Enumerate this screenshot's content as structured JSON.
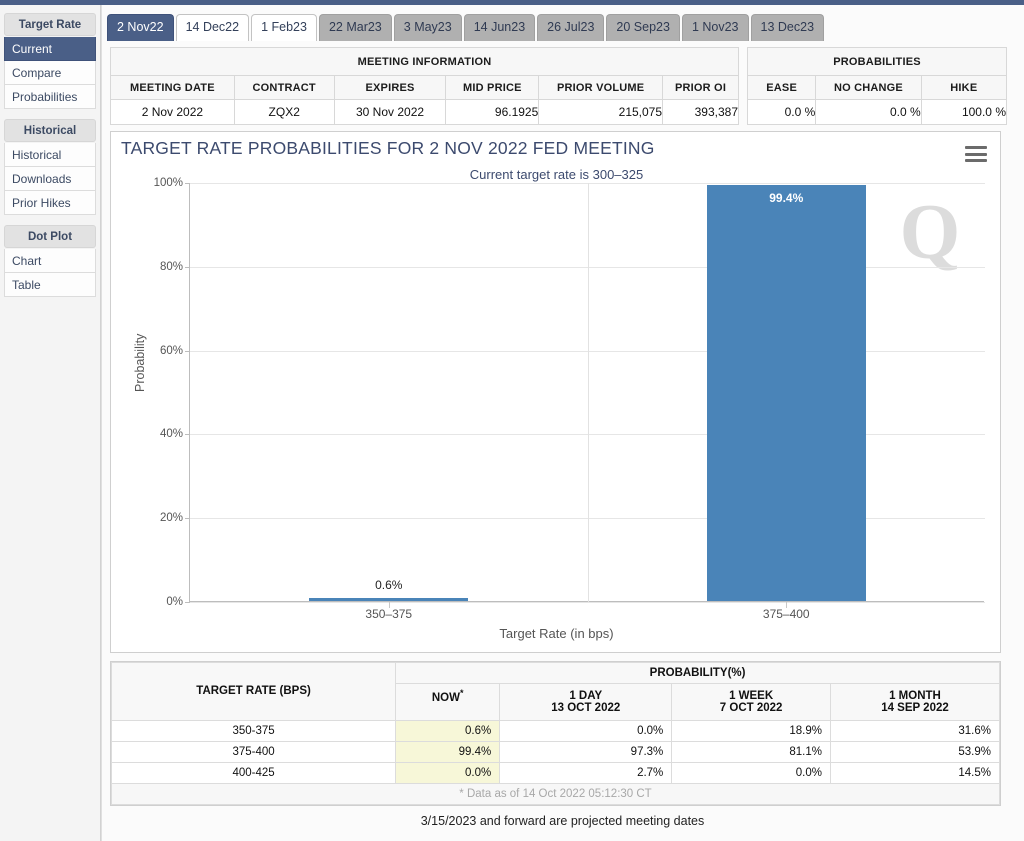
{
  "sidebar": {
    "groups": [
      {
        "title": "Target Rate",
        "items": [
          {
            "label": "Current",
            "active": true
          },
          {
            "label": "Compare",
            "active": false
          },
          {
            "label": "Probabilities",
            "active": false
          }
        ]
      },
      {
        "title": "Historical",
        "items": [
          {
            "label": "Historical",
            "active": false
          },
          {
            "label": "Downloads",
            "active": false
          },
          {
            "label": "Prior Hikes",
            "active": false
          }
        ]
      },
      {
        "title": "Dot Plot",
        "items": [
          {
            "label": "Chart",
            "active": false
          },
          {
            "label": "Table",
            "active": false
          }
        ]
      }
    ]
  },
  "tabs": [
    {
      "label": "2 Nov22",
      "state": "active"
    },
    {
      "label": "14 Dec22",
      "state": "white"
    },
    {
      "label": "1 Feb23",
      "state": "white"
    },
    {
      "label": "22 Mar23",
      "state": "grey"
    },
    {
      "label": "3 May23",
      "state": "grey"
    },
    {
      "label": "14 Jun23",
      "state": "grey"
    },
    {
      "label": "26 Jul23",
      "state": "grey"
    },
    {
      "label": "20 Sep23",
      "state": "grey"
    },
    {
      "label": "1 Nov23",
      "state": "grey"
    },
    {
      "label": "13 Dec23",
      "state": "grey"
    }
  ],
  "meeting_information": {
    "caption": "MEETING INFORMATION",
    "headers": [
      "MEETING DATE",
      "CONTRACT",
      "EXPIRES",
      "MID PRICE",
      "PRIOR VOLUME",
      "PRIOR OI"
    ],
    "values": [
      "2 Nov 2022",
      "ZQX2",
      "30 Nov 2022",
      "96.1925",
      "215,075",
      "393,387"
    ]
  },
  "probabilities_summary": {
    "caption": "PROBABILITIES",
    "headers": [
      "EASE",
      "NO CHANGE",
      "HIKE"
    ],
    "values": [
      "0.0 %",
      "0.0 %",
      "100.0 %"
    ]
  },
  "chart_data": {
    "type": "bar",
    "title": "TARGET RATE PROBABILITIES FOR 2 NOV 2022 FED MEETING",
    "subtitle": "Current target rate is 300–325",
    "categories": [
      "350–375",
      "375–400"
    ],
    "values": [
      0.6,
      99.4
    ],
    "data_labels": [
      "0.6%",
      "99.4%"
    ],
    "xlabel": "Target Rate (in bps)",
    "ylabel": "Probability",
    "ylim": [
      0,
      100
    ],
    "yticks": [
      0,
      20,
      40,
      60,
      80,
      100
    ],
    "ytick_labels": [
      "0%",
      "20%",
      "40%",
      "60%",
      "80%",
      "100%"
    ],
    "grid": true,
    "legend": "none",
    "bar_color": "#4a84b8",
    "title_color": "#3c4a6e",
    "watermark": "Q"
  },
  "data_table": {
    "col_rate": "TARGET RATE (BPS)",
    "group_header": "PROBABILITY(%)",
    "columns": [
      {
        "title": "NOW",
        "sub": "",
        "star": true
      },
      {
        "title": "1 DAY",
        "sub": "13 OCT 2022",
        "star": false
      },
      {
        "title": "1 WEEK",
        "sub": "7 OCT 2022",
        "star": false
      },
      {
        "title": "1 MONTH",
        "sub": "14 SEP 2022",
        "star": false
      }
    ],
    "rows": [
      {
        "rate": "350-375",
        "now": "0.6%",
        "day": "0.0%",
        "week": "18.9%",
        "month": "31.6%"
      },
      {
        "rate": "375-400",
        "now": "99.4%",
        "day": "97.3%",
        "week": "81.1%",
        "month": "53.9%"
      },
      {
        "rate": "400-425",
        "now": "0.0%",
        "day": "2.7%",
        "week": "0.0%",
        "month": "14.5%"
      }
    ],
    "note": "* Data as of 14 Oct 2022 05:12:30 CT"
  },
  "footer_note": "3/15/2023 and forward are projected meeting dates"
}
